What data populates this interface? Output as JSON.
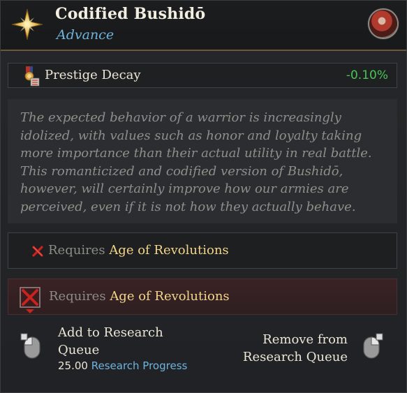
{
  "header": {
    "title": "Codified Bushidō",
    "subtitle": "Advance",
    "icon": "gold-star-icon",
    "portrait": "character-portrait"
  },
  "modifier": {
    "icon": "prestige-medal-icon",
    "label": "Prestige Decay",
    "value": "-0.10%"
  },
  "description": "The expected behavior of a warrior is increasingly idolized, with values such as honor and loyalty taking more importance than their actual utility in real battle. This romanticized and codified version of Bushidō, however, will certainly improve how our armies are perceived, even if it is not how they actually behave.",
  "requirements": [
    {
      "prefix": "Requires",
      "name": "Age of Revolutions"
    },
    {
      "prefix": "Requires",
      "name": "Age of Revolutions"
    }
  ],
  "actions": {
    "left": {
      "label_line1": "Add to Research",
      "label_line2": "Queue",
      "progress_value": "25.00",
      "progress_label": "Research Progress"
    },
    "right": {
      "label_line1": "Remove from",
      "label_line2": "Research Queue"
    }
  },
  "colors": {
    "accent_blue": "#6fb4dd",
    "positive_green": "#49c653",
    "highlight_gold": "#f2d58a",
    "unmet_red": "#c8231f"
  }
}
